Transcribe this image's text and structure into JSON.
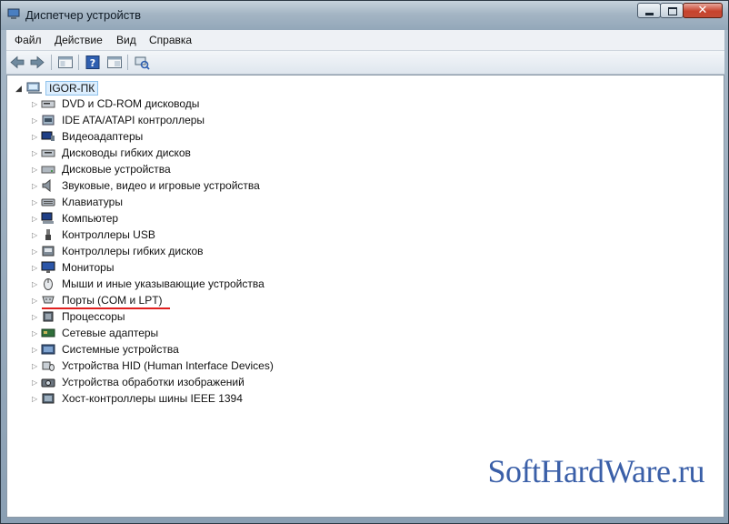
{
  "window": {
    "title": "Диспетчер устройств",
    "controls": {
      "minimize_icon": "minimize-icon",
      "maximize_icon": "maximize-icon",
      "close_icon": "close-icon",
      "close_glyph": "✕"
    }
  },
  "menubar": {
    "items": [
      "Файл",
      "Действие",
      "Вид",
      "Справка"
    ]
  },
  "toolbar": {
    "buttons": [
      "back-arrow-icon",
      "forward-arrow-icon",
      "properties-icon",
      "help-icon",
      "show-hide-console-tree-icon",
      "scan-hardware-icon"
    ]
  },
  "tree": {
    "root_label": "IGOR-ПК",
    "expander_open": "◢",
    "expander_closed": "▷",
    "items": [
      {
        "label": "DVD и CD-ROM дисководы",
        "icon": "dvd-drive-icon"
      },
      {
        "label": "IDE ATA/ATAPI контроллеры",
        "icon": "ide-controller-icon"
      },
      {
        "label": "Видеоадаптеры",
        "icon": "display-adapter-icon"
      },
      {
        "label": "Дисководы гибких дисков",
        "icon": "floppy-drive-icon"
      },
      {
        "label": "Дисковые устройства",
        "icon": "disk-drive-icon"
      },
      {
        "label": "Звуковые, видео и игровые устройства",
        "icon": "speaker-icon"
      },
      {
        "label": "Клавиатуры",
        "icon": "keyboard-icon"
      },
      {
        "label": "Компьютер",
        "icon": "computer-icon"
      },
      {
        "label": "Контроллеры USB",
        "icon": "usb-icon"
      },
      {
        "label": "Контроллеры гибких дисков",
        "icon": "floppy-controller-icon"
      },
      {
        "label": "Мониторы",
        "icon": "monitor-icon"
      },
      {
        "label": "Мыши и иные указывающие устройства",
        "icon": "mouse-icon"
      },
      {
        "label": "Порты (COM и LPT)",
        "icon": "port-icon"
      },
      {
        "label": "Процессоры",
        "icon": "processor-icon"
      },
      {
        "label": "Сетевые адаптеры",
        "icon": "network-adapter-icon"
      },
      {
        "label": "Системные устройства",
        "icon": "system-device-icon"
      },
      {
        "label": "Устройства HID (Human Interface Devices)",
        "icon": "hid-icon"
      },
      {
        "label": "Устройства обработки изображений",
        "icon": "imaging-device-icon"
      },
      {
        "label": "Хост-контроллеры шины IEEE 1394",
        "icon": "ieee1394-icon"
      }
    ]
  },
  "annotation": {
    "highlight_color": "#e0201f"
  },
  "watermark": {
    "text": "SoftHardWare.ru",
    "color": "#3a5fa8"
  }
}
